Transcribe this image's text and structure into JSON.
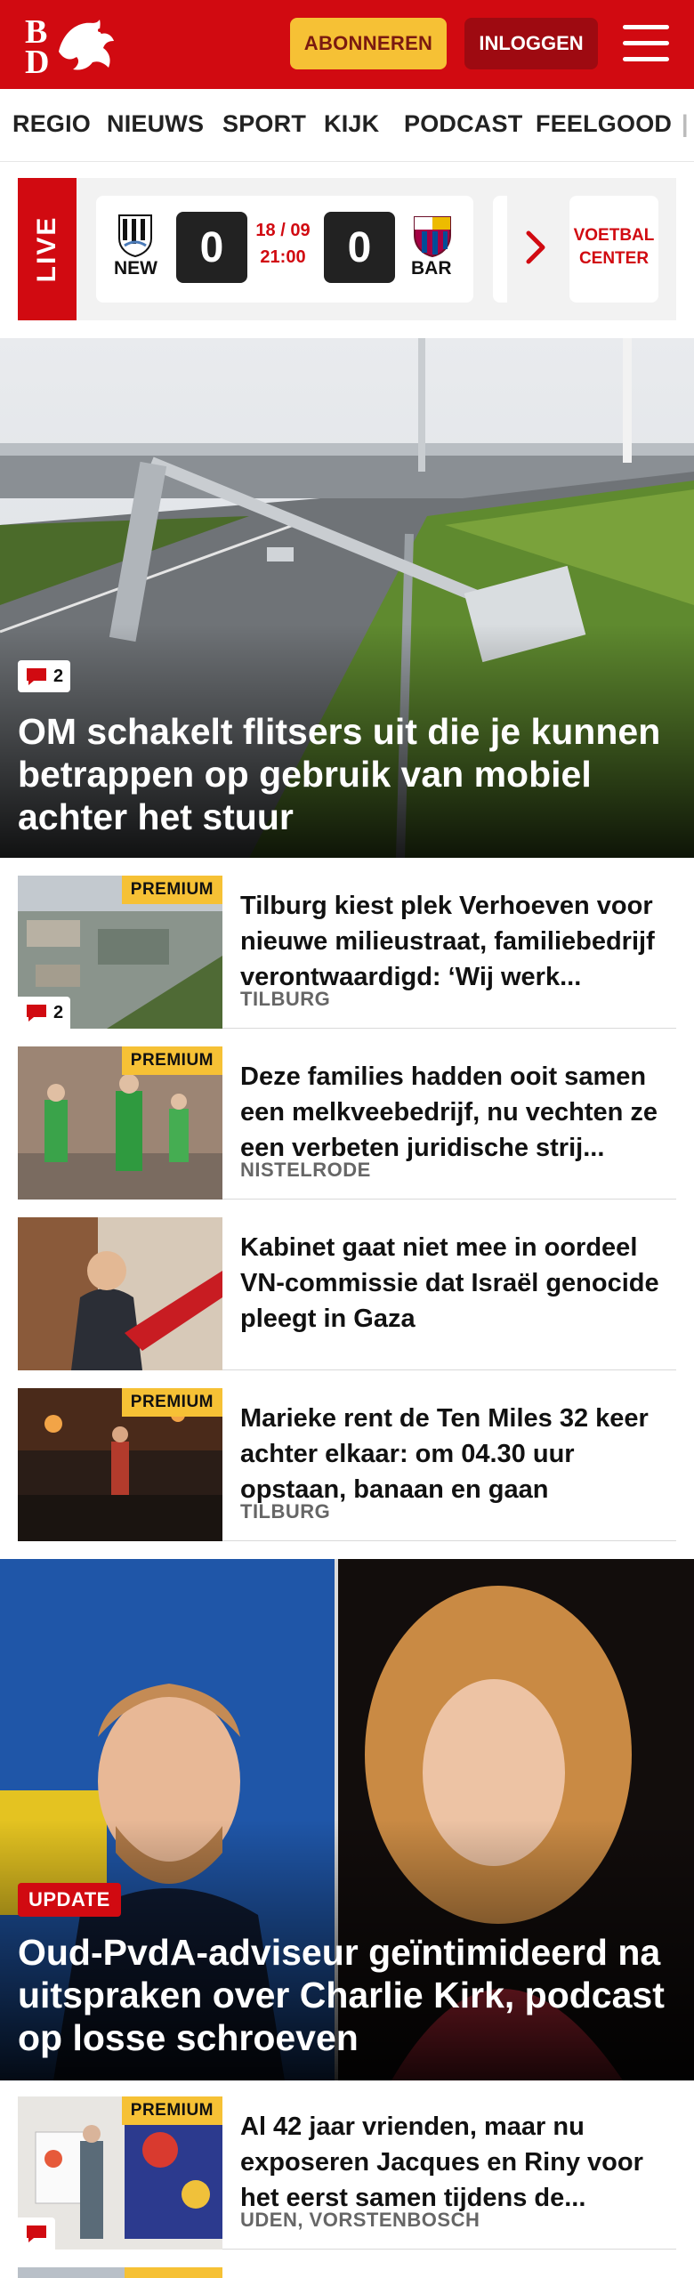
{
  "header": {
    "logo_line1": "B",
    "logo_line2": "D",
    "subscribe_label": "ABONNEREN",
    "login_label": "INLOGGEN"
  },
  "nav": {
    "items": [
      "REGIO",
      "NIEUWS",
      "SPORT",
      "KIJK",
      "PODCAST",
      "FEELGOOD"
    ]
  },
  "live": {
    "label": "LIVE",
    "home_team": "NEW",
    "home_score": "0",
    "date": "18 / 09",
    "time": "21:00",
    "away_score": "0",
    "away_team": "BAR",
    "center_line1": "VOETBAL",
    "center_line2": "CENTER"
  },
  "hero": {
    "comment_count": "2",
    "title": "OM schakelt flitsers uit die je kunnen betrappen op gebruik van mobiel achter het stuur"
  },
  "articles": [
    {
      "premium": "PREMIUM",
      "comment_count": "2",
      "title": "Tilburg kiest plek Verhoeven voor nieuwe milieustraat, familiebe­drijf verontwaardigd: ‘Wij werk...",
      "location": "TILBURG"
    },
    {
      "premium": "PREMIUM",
      "title": "Deze families hadden ooit samen een melkveebedrijf, nu vechten ze een verbeten juridische strij...",
      "location": "NISTELRODE"
    },
    {
      "title": "Kabinet gaat niet mee in oordeel VN-commissie dat Israël genocide pleegt in Gaza"
    },
    {
      "premium": "PREMIUM",
      "title": "Marieke rent de Ten Miles 32 keer achter elkaar: om 04.30 uur opstaan, banaan en gaan",
      "location": "TILBURG"
    }
  ],
  "hero2": {
    "badge": "UPDATE",
    "title": "Oud-PvdA-adviseur geïntimideerd na uitspraken over Charlie Kirk, podcast op losse schroeven"
  },
  "article5": {
    "premium": "PREMIUM",
    "title": "Al 42 jaar vrienden, maar nu exposeren Jacques en Riny voor het eerst samen tijdens de...",
    "location": "UDEN, VORSTENBOSCH"
  },
  "article6": {
    "premium": "PREMIUM"
  },
  "colors": {
    "brand_red": "#d10a11",
    "premium_yellow": "#f6c135",
    "login_dark_red": "#9e0a11"
  }
}
